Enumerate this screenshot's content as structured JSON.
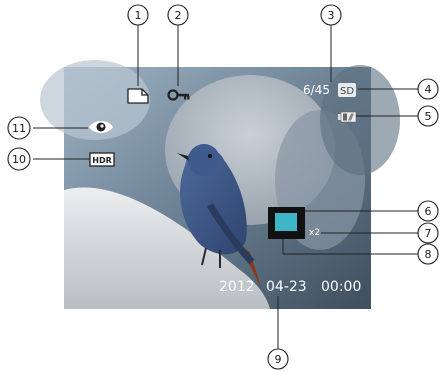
{
  "callouts": [
    {
      "id": "1",
      "label": "1"
    },
    {
      "id": "2",
      "label": "2"
    },
    {
      "id": "3",
      "label": "3"
    },
    {
      "id": "4",
      "label": "4"
    },
    {
      "id": "5",
      "label": "5"
    },
    {
      "id": "6",
      "label": "6"
    },
    {
      "id": "7",
      "label": "7"
    },
    {
      "id": "8",
      "label": "8"
    },
    {
      "id": "9",
      "label": "9"
    },
    {
      "id": "10",
      "label": "10"
    },
    {
      "id": "11",
      "label": "11"
    }
  ],
  "screen": {
    "file_counter": "6/45",
    "storage_badge": "SD",
    "hdr_badge": "HDR",
    "zoom_label": "x2",
    "date": "2012",
    "month_day": "04-23",
    "time": "00:00",
    "icons": {
      "protect": "key-icon",
      "file": "document-icon",
      "battery": "battery-icon",
      "eye": "eye-icon"
    }
  },
  "colors": {
    "thumbnail": "#3fb6c6",
    "hud_text": "#ffffff"
  }
}
